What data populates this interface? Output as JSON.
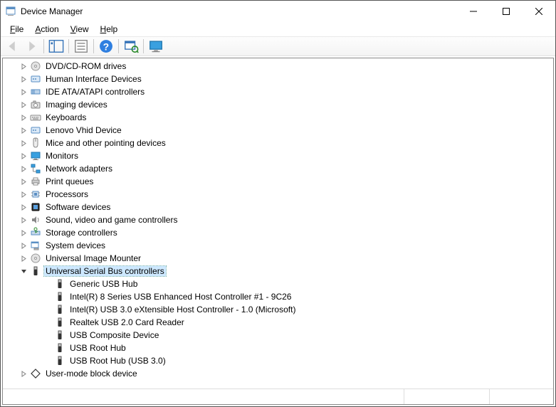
{
  "window": {
    "title": "Device Manager"
  },
  "menu": {
    "file": "File",
    "action": "Action",
    "view": "View",
    "help": "Help"
  },
  "toolbar": {
    "back": "Back",
    "forward": "Forward",
    "show_hide_tree": "Show/Hide Console Tree",
    "properties": "Properties",
    "help": "Help",
    "scan": "Scan for hardware changes",
    "monitor": "Show hidden devices"
  },
  "tree": {
    "categories": [
      {
        "label": "DVD/CD-ROM drives",
        "icon": "disc",
        "expanded": false
      },
      {
        "label": "Human Interface Devices",
        "icon": "hid",
        "expanded": false
      },
      {
        "label": "IDE ATA/ATAPI controllers",
        "icon": "ide",
        "expanded": false
      },
      {
        "label": "Imaging devices",
        "icon": "camera",
        "expanded": false
      },
      {
        "label": "Keyboards",
        "icon": "keyboard",
        "expanded": false
      },
      {
        "label": "Lenovo Vhid Device",
        "icon": "hid",
        "expanded": false
      },
      {
        "label": "Mice and other pointing devices",
        "icon": "mouse",
        "expanded": false
      },
      {
        "label": "Monitors",
        "icon": "monitor",
        "expanded": false
      },
      {
        "label": "Network adapters",
        "icon": "network",
        "expanded": false
      },
      {
        "label": "Print queues",
        "icon": "printer",
        "expanded": false
      },
      {
        "label": "Processors",
        "icon": "cpu",
        "expanded": false
      },
      {
        "label": "Software devices",
        "icon": "software",
        "expanded": false
      },
      {
        "label": "Sound, video and game controllers",
        "icon": "sound",
        "expanded": false
      },
      {
        "label": "Storage controllers",
        "icon": "storage",
        "expanded": false
      },
      {
        "label": "System devices",
        "icon": "system",
        "expanded": false
      },
      {
        "label": "Universal Image Mounter",
        "icon": "disc",
        "expanded": false
      },
      {
        "label": "Universal Serial Bus controllers",
        "icon": "usb",
        "expanded": true,
        "selected": true,
        "children": [
          {
            "label": "Generic USB Hub",
            "icon": "usb"
          },
          {
            "label": "Intel(R) 8 Series USB Enhanced Host Controller #1 - 9C26",
            "icon": "usb"
          },
          {
            "label": "Intel(R) USB 3.0 eXtensible Host Controller - 1.0 (Microsoft)",
            "icon": "usb"
          },
          {
            "label": "Realtek USB 2.0 Card Reader",
            "icon": "usb"
          },
          {
            "label": "USB Composite Device",
            "icon": "usb"
          },
          {
            "label": "USB Root Hub",
            "icon": "usb"
          },
          {
            "label": "USB Root Hub (USB 3.0)",
            "icon": "usb"
          }
        ]
      },
      {
        "label": "User-mode block device",
        "icon": "diamond",
        "expanded": false
      }
    ]
  }
}
